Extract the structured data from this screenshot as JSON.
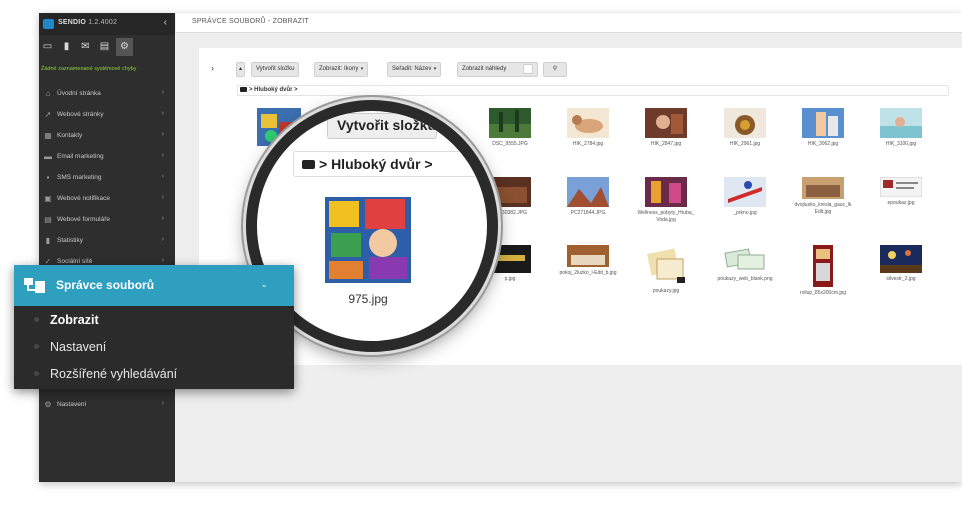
{
  "app": {
    "name": "SENDIO",
    "version": "1.2.4002"
  },
  "sidebar": {
    "status": "Žádné zaznamenané systémové chyby",
    "toolbar_icons": [
      "dashboard-icon",
      "file-icon",
      "mail-icon",
      "chat-icon",
      "settings-icon"
    ],
    "items": [
      {
        "label": "Úvodní stránka",
        "icon": "home-icon"
      },
      {
        "label": "Webové stránky",
        "icon": "cursor-icon"
      },
      {
        "label": "Kontakty",
        "icon": "contacts-icon"
      },
      {
        "label": "Email marketing",
        "icon": "email-icon"
      },
      {
        "label": "SMS marketing",
        "icon": "sms-icon"
      },
      {
        "label": "Webové notifikace",
        "icon": "notification-icon"
      },
      {
        "label": "Webové formuláře",
        "icon": "form-icon"
      },
      {
        "label": "Statistiky",
        "icon": "stats-icon"
      },
      {
        "label": "Sociální sítě",
        "icon": "social-icon"
      },
      {
        "label": "Nastavení",
        "icon": "gear-icon"
      }
    ]
  },
  "header": {
    "title": "SPRÁVCE SOUBORŮ - ZOBRAZIT"
  },
  "toolbar": {
    "create_folder": "Vytvořit složku",
    "view": "Zobrazit: Ikony",
    "sort": "Seřadit: Název",
    "show_previews": "Zobrazit náhledy"
  },
  "breadcrumb": "> Hluboký dvůr >",
  "files": [
    {
      "name": "DSC_9555.JPG"
    },
    {
      "name": "HIK_2784.jpg"
    },
    {
      "name": "HIK_2847.jpg"
    },
    {
      "name": "HIK_2961.jpg"
    },
    {
      "name": "HIK_3062.jpg"
    },
    {
      "name": "HIK_3100.jpg"
    },
    {
      "name": "P1230382.JPG"
    },
    {
      "name": "PC271844.JPG"
    },
    {
      "name": "Wellness_pobyty_Hruba_Voda.jpg"
    },
    {
      "name": "_prkno.jpg"
    },
    {
      "name": "dvojluzko_kresla_gauc_lkEdit.jpg"
    },
    {
      "name": "epoukaz.jpg"
    },
    {
      "name": "p.jpg"
    },
    {
      "name": "pokoj_2luzko_l-Edit_b.jpg"
    },
    {
      "name": "poukazy.jpg"
    },
    {
      "name": "poukazy_web_blank.png"
    },
    {
      "name": "rollup_85x200cm.jpg"
    },
    {
      "name": "silvestr_2.jpg"
    }
  ],
  "magnifier": {
    "ghost_button": "Vytvořit složku",
    "breadcrumb": "> Hluboký dvůr >",
    "file_name": "975.jpg"
  },
  "flyout": {
    "title": "Správce souborů",
    "items": [
      "Zobrazit",
      "Nastavení",
      "Rozšířené vyhledávání"
    ]
  },
  "colors": {
    "accent": "#2f9fc0",
    "sidebar": "#2e2e2e",
    "status_ok": "#8bd43a"
  }
}
